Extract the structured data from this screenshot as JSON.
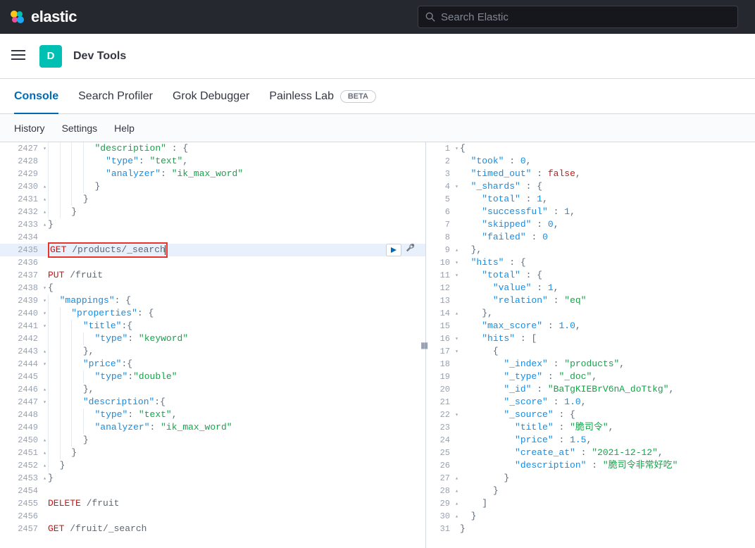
{
  "brand": "elastic",
  "search_placeholder": "Search Elastic",
  "badge_letter": "D",
  "page_title": "Dev Tools",
  "tabs": {
    "console": "Console",
    "profiler": "Search Profiler",
    "grok": "Grok Debugger",
    "painless": "Painless Lab",
    "beta": "BETA"
  },
  "subtabs": {
    "history": "History",
    "settings": "Settings",
    "help": "Help"
  },
  "left_lines": [
    {
      "n": 2427,
      "fold": "▾",
      "html": "<span class='indent-guide'> </span> <span class='indent-guide'> </span> <span class='indent-guide'> </span> <span class='indent-guide'> </span> <span class='tok-str'>\"description\"</span> <span class='tok-punc'>: {</span>"
    },
    {
      "n": 2428,
      "html": "<span class='indent-guide'> </span> <span class='indent-guide'> </span> <span class='indent-guide'> </span> <span class='indent-guide'> </span>   <span class='tok-prop'>\"type\"</span><span class='tok-punc'>: </span><span class='tok-str'>\"text\"</span><span class='tok-punc'>,</span>"
    },
    {
      "n": 2429,
      "html": "<span class='indent-guide'> </span> <span class='indent-guide'> </span> <span class='indent-guide'> </span> <span class='indent-guide'> </span>   <span class='tok-prop'>\"analyzer\"</span><span class='tok-punc'>: </span><span class='tok-str'>\"ik_max_word\"</span>"
    },
    {
      "n": 2430,
      "fold": "▴",
      "html": "<span class='indent-guide'> </span> <span class='indent-guide'> </span> <span class='indent-guide'> </span> <span class='indent-guide'> </span> <span class='tok-punc'>}</span>"
    },
    {
      "n": 2431,
      "fold": "▴",
      "html": "<span class='indent-guide'> </span> <span class='indent-guide'> </span> <span class='indent-guide'> </span> <span class='tok-punc'>}</span>"
    },
    {
      "n": 2432,
      "fold": "▴",
      "html": "<span class='indent-guide'> </span> <span class='indent-guide'> </span> <span class='tok-punc'>}</span>"
    },
    {
      "n": 2433,
      "fold": "▴",
      "html": "<span class='tok-punc'>}</span>"
    },
    {
      "n": 2434,
      "html": ""
    },
    {
      "n": 2435,
      "hl": true,
      "box": true,
      "html": "<span class='tok-kw'>GET</span> <span class='tok-path'>/products/_search</span>"
    },
    {
      "n": 2436,
      "html": ""
    },
    {
      "n": 2437,
      "html": "<span class='tok-kw'>PUT</span> <span class='tok-path'>/fruit</span>"
    },
    {
      "n": 2438,
      "fold": "▾",
      "html": "<span class='tok-punc'>{</span>"
    },
    {
      "n": 2439,
      "fold": "▾",
      "html": "<span class='indent-guide'> </span> <span class='tok-prop'>\"mappings\"</span><span class='tok-punc'>: {</span>"
    },
    {
      "n": 2440,
      "fold": "▾",
      "html": "<span class='indent-guide'> </span> <span class='indent-guide'> </span> <span class='tok-prop'>\"properties\"</span><span class='tok-punc'>: {</span>"
    },
    {
      "n": 2441,
      "fold": "▾",
      "html": "<span class='indent-guide'> </span> <span class='indent-guide'> </span> <span class='indent-guide'> </span> <span class='tok-prop'>\"title\"</span><span class='tok-punc'>:{</span>"
    },
    {
      "n": 2442,
      "html": "<span class='indent-guide'> </span> <span class='indent-guide'> </span> <span class='indent-guide'> </span> <span class='indent-guide'> </span> <span class='tok-prop'>\"type\"</span><span class='tok-punc'>: </span><span class='tok-str'>\"keyword\"</span>"
    },
    {
      "n": 2443,
      "fold": "▴",
      "html": "<span class='indent-guide'> </span> <span class='indent-guide'> </span> <span class='indent-guide'> </span> <span class='tok-punc'>},</span>"
    },
    {
      "n": 2444,
      "fold": "▾",
      "html": "<span class='indent-guide'> </span> <span class='indent-guide'> </span> <span class='indent-guide'> </span> <span class='tok-prop'>\"price\"</span><span class='tok-punc'>:{</span>"
    },
    {
      "n": 2445,
      "html": "<span class='indent-guide'> </span> <span class='indent-guide'> </span> <span class='indent-guide'> </span> <span class='indent-guide'> </span> <span class='tok-prop'>\"type\"</span><span class='tok-punc'>:</span><span class='tok-str'>\"double\"</span>"
    },
    {
      "n": 2446,
      "fold": "▴",
      "html": "<span class='indent-guide'> </span> <span class='indent-guide'> </span> <span class='indent-guide'> </span> <span class='tok-punc'>},</span>"
    },
    {
      "n": 2447,
      "fold": "▾",
      "html": "<span class='indent-guide'> </span> <span class='indent-guide'> </span> <span class='indent-guide'> </span> <span class='tok-prop'>\"description\"</span><span class='tok-punc'>:{</span>"
    },
    {
      "n": 2448,
      "html": "<span class='indent-guide'> </span> <span class='indent-guide'> </span> <span class='indent-guide'> </span> <span class='indent-guide'> </span> <span class='tok-prop'>\"type\"</span><span class='tok-punc'>: </span><span class='tok-str'>\"text\"</span><span class='tok-punc'>,</span>"
    },
    {
      "n": 2449,
      "html": "<span class='indent-guide'> </span> <span class='indent-guide'> </span> <span class='indent-guide'> </span> <span class='indent-guide'> </span> <span class='tok-prop'>\"analyzer\"</span><span class='tok-punc'>: </span><span class='tok-str'>\"ik_max_word\"</span>"
    },
    {
      "n": 2450,
      "fold": "▴",
      "html": "<span class='indent-guide'> </span> <span class='indent-guide'> </span> <span class='indent-guide'> </span> <span class='tok-punc'>}</span>"
    },
    {
      "n": 2451,
      "fold": "▴",
      "html": "<span class='indent-guide'> </span> <span class='indent-guide'> </span> <span class='tok-punc'>}</span>"
    },
    {
      "n": 2452,
      "fold": "▴",
      "html": "<span class='indent-guide'> </span> <span class='tok-punc'>}</span>"
    },
    {
      "n": 2453,
      "fold": "▴",
      "html": "<span class='tok-punc'>}</span>"
    },
    {
      "n": 2454,
      "html": ""
    },
    {
      "n": 2455,
      "html": "<span class='tok-kw'>DELETE</span> <span class='tok-path'>/fruit</span>"
    },
    {
      "n": 2456,
      "html": ""
    },
    {
      "n": 2457,
      "html": "<span class='tok-kw'>GET</span> <span class='tok-path'>/fruit/_search</span>"
    }
  ],
  "right_lines": [
    {
      "n": 1,
      "fold": "▾",
      "html": "<span class='tok-punc'>{</span>"
    },
    {
      "n": 2,
      "html": "  <span class='tok-prop'>\"took\"</span> <span class='tok-punc'>:</span> <span class='tok-num'>0</span><span class='tok-punc'>,</span>"
    },
    {
      "n": 3,
      "html": "  <span class='tok-prop'>\"timed_out\"</span> <span class='tok-punc'>:</span> <span class='tok-bool'>false</span><span class='tok-punc'>,</span>"
    },
    {
      "n": 4,
      "fold": "▾",
      "html": "  <span class='tok-prop'>\"_shards\"</span> <span class='tok-punc'>: {</span>"
    },
    {
      "n": 5,
      "html": "    <span class='tok-prop'>\"total\"</span> <span class='tok-punc'>:</span> <span class='tok-num'>1</span><span class='tok-punc'>,</span>"
    },
    {
      "n": 6,
      "html": "    <span class='tok-prop'>\"successful\"</span> <span class='tok-punc'>:</span> <span class='tok-num'>1</span><span class='tok-punc'>,</span>"
    },
    {
      "n": 7,
      "html": "    <span class='tok-prop'>\"skipped\"</span> <span class='tok-punc'>:</span> <span class='tok-num'>0</span><span class='tok-punc'>,</span>"
    },
    {
      "n": 8,
      "html": "    <span class='tok-prop'>\"failed\"</span> <span class='tok-punc'>:</span> <span class='tok-num'>0</span>"
    },
    {
      "n": 9,
      "fold": "▴",
      "html": "  <span class='tok-punc'>},</span>"
    },
    {
      "n": 10,
      "fold": "▾",
      "html": "  <span class='tok-prop'>\"hits\"</span> <span class='tok-punc'>: {</span>"
    },
    {
      "n": 11,
      "fold": "▾",
      "html": "    <span class='tok-prop'>\"total\"</span> <span class='tok-punc'>: {</span>"
    },
    {
      "n": 12,
      "html": "      <span class='tok-prop'>\"value\"</span> <span class='tok-punc'>:</span> <span class='tok-num'>1</span><span class='tok-punc'>,</span>"
    },
    {
      "n": 13,
      "html": "      <span class='tok-prop'>\"relation\"</span> <span class='tok-punc'>:</span> <span class='tok-str'>\"eq\"</span>"
    },
    {
      "n": 14,
      "fold": "▴",
      "html": "    <span class='tok-punc'>},</span>"
    },
    {
      "n": 15,
      "html": "    <span class='tok-prop'>\"max_score\"</span> <span class='tok-punc'>:</span> <span class='tok-num'>1.0</span><span class='tok-punc'>,</span>"
    },
    {
      "n": 16,
      "fold": "▾",
      "html": "    <span class='tok-prop'>\"hits\"</span> <span class='tok-punc'>: [</span>"
    },
    {
      "n": 17,
      "fold": "▾",
      "html": "      <span class='tok-punc'>{</span>"
    },
    {
      "n": 18,
      "html": "        <span class='tok-prop'>\"_index\"</span> <span class='tok-punc'>:</span> <span class='tok-str'>\"products\"</span><span class='tok-punc'>,</span>"
    },
    {
      "n": 19,
      "html": "        <span class='tok-prop'>\"_type\"</span> <span class='tok-punc'>:</span> <span class='tok-str'>\"_doc\"</span><span class='tok-punc'>,</span>"
    },
    {
      "n": 20,
      "html": "        <span class='tok-prop'>\"_id\"</span> <span class='tok-punc'>:</span> <span class='tok-str'>\"BaTgKIEBrV6nA_doTtkg\"</span><span class='tok-punc'>,</span>"
    },
    {
      "n": 21,
      "html": "        <span class='tok-prop'>\"_score\"</span> <span class='tok-punc'>:</span> <span class='tok-num'>1.0</span><span class='tok-punc'>,</span>"
    },
    {
      "n": 22,
      "fold": "▾",
      "html": "        <span class='tok-prop'>\"_source\"</span> <span class='tok-punc'>: {</span>"
    },
    {
      "n": 23,
      "html": "          <span class='tok-prop'>\"title\"</span> <span class='tok-punc'>:</span> <span class='tok-str'>\"脆司令\"</span><span class='tok-punc'>,</span>"
    },
    {
      "n": 24,
      "html": "          <span class='tok-prop'>\"price\"</span> <span class='tok-punc'>:</span> <span class='tok-num'>1.5</span><span class='tok-punc'>,</span>"
    },
    {
      "n": 25,
      "html": "          <span class='tok-prop'>\"create_at\"</span> <span class='tok-punc'>:</span> <span class='tok-str'>\"2021-12-12\"</span><span class='tok-punc'>,</span>"
    },
    {
      "n": 26,
      "html": "          <span class='tok-prop'>\"description\"</span> <span class='tok-punc'>:</span> <span class='tok-str'>\"脆司令非常好吃\"</span>"
    },
    {
      "n": 27,
      "fold": "▴",
      "html": "        <span class='tok-punc'>}</span>"
    },
    {
      "n": 28,
      "fold": "▴",
      "html": "      <span class='tok-punc'>}</span>"
    },
    {
      "n": 29,
      "fold": "▴",
      "html": "    <span class='tok-punc'>]</span>"
    },
    {
      "n": 30,
      "fold": "▴",
      "html": "  <span class='tok-punc'>}</span>"
    },
    {
      "n": 31,
      "html": "<span class='tok-punc'>}</span>"
    }
  ]
}
